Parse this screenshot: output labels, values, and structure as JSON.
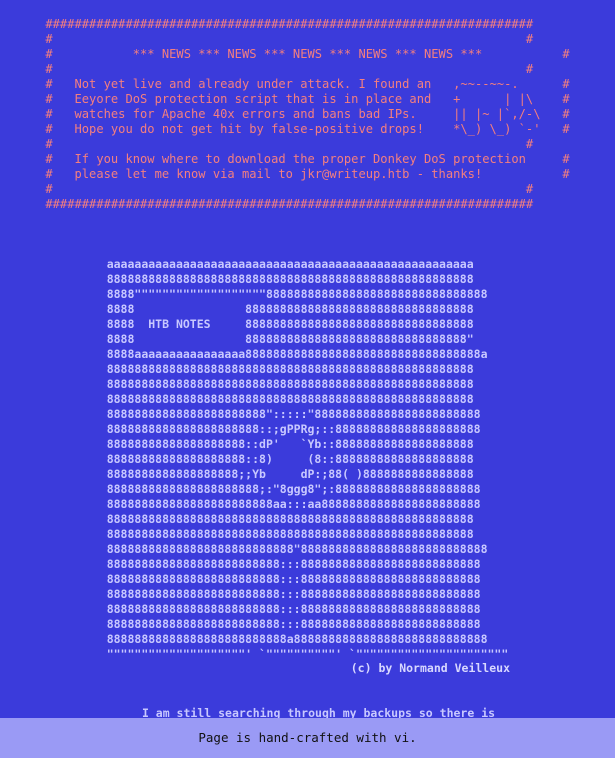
{
  "news_banner": "###################################################################\n#                                                                 #\n#           *** NEWS *** NEWS *** NEWS *** NEWS *** NEWS ***           #\n#                                                                 #\n#   Not yet live and already under attack. I found an   ,~~--~~-.      #\n#   Eeyore DoS protection script that is in place and   +      | |\\    #\n#   watches for Apache 40x errors and bans bad IPs.     || |~ |`,/-\\   #\n#   Hope you do not get hit by false-positive drops!    *\\_) \\_) `-'   #\n#                                                                 #\n#   If you know where to download the proper Donkey DoS protection     #\n#   please let me know via mail to jkr@writeup.htb - thanks!           #\n#                                                                 #\n###################################################################",
  "logo_art": "aaaaaaaaaaaaaaaaaaaaaaaaaaaaaaaaaaaaaaaaaaaaaaaaaaaaa\n88888888888888888888888888888888888888888888888888888\n8888\"\"\"\"\"\"\"\"\"\"\"\"\"\"\"\"\"\"\"88888888888888888888888888888888\n8888                888888888888888888888888888888888\n8888  HTB NOTES     888888888888888888888888888888888\n8888                88888888888888888888888888888888\"\n8888aaaaaaaaaaaaaaaa8888888888888888888888888888888888a\n88888888888888888888888888888888888888888888888888888\n88888888888888888888888888888888888888888888888888888\n88888888888888888888888888888888888888888888888888888\n88888888888888888888888\":::::\"888888888888888888888888\n8888888888888888888888::;gPPRg;::888888888888888888888\n88888888888888888888::dP'   `Yb::88888888888888888888\n88888888888888888888::8)     (8::88888888888888888888\n8888888888888888888;;Yb     dP:;88( )8888888888888888\n8888888888888888888888;:\"8ggg8\";:888888888888888888888\n888888888888888888888888aa:::aa88888888888888888888888\n88888888888888888888888888888888888888888888888888888\n88888888888888888888888888888888888888888888888888888\n888888888888888888888888888\"888888888888888888888888888\n8888888888888888888888888:::88888888888888888888888888\n8888888888888888888888888:::88888888888888888888888888\n8888888888888888888888888:::88888888888888888888888888\n8888888888888888888888888:::88888888888888888888888888\n8888888888888888888888888:::88888888888888888888888888\n88888888888888888888888888a8888888888888888888888888888\n\"\"\"\"\"\"\"\"\"\"\"\"\"\"\"\"\"\"\"\"' `\"\"\"\"\"\"\"\"\"\"' `\"\"\"\"\"\"\"\"\"\"\"\"\"\"\"\"\"\"\"\"\"\"",
  "byline": "(c) by Normand Veilleux",
  "note": "I am still searching through my backups so there is",
  "footer": "Page is hand-crafted with vi."
}
